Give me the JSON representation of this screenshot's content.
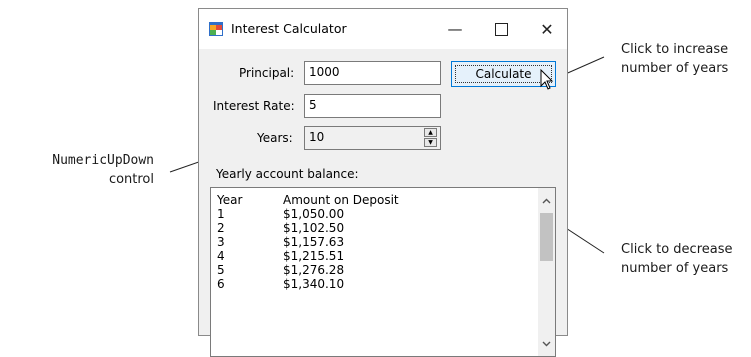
{
  "window": {
    "title": "Interest Calculator",
    "controls": {
      "minimize": "—",
      "maximize": "",
      "close": "✕"
    }
  },
  "form": {
    "principal_label": "Principal:",
    "principal_value": "1000",
    "rate_label": "Interest Rate:",
    "rate_value": "5",
    "years_label": "Years:",
    "years_value": "10",
    "calculate_label": "Calculate",
    "balance_label": "Yearly account balance:"
  },
  "results": {
    "headers": [
      "Year",
      "Amount on Deposit"
    ],
    "rows": [
      [
        "1",
        "$1,050.00"
      ],
      [
        "2",
        "$1,102.50"
      ],
      [
        "3",
        "$1,157.63"
      ],
      [
        "4",
        "$1,215.51"
      ],
      [
        "5",
        "$1,276.28"
      ],
      [
        "6",
        "$1,340.10"
      ]
    ]
  },
  "annotations": {
    "updown_name": "NumericUpDown",
    "updown_suffix": "control",
    "increase_line1": "Click to increase",
    "increase_line2": "number of years",
    "decrease_line1": "Click to decrease",
    "decrease_line2": "number of years"
  },
  "icons": {
    "app": "app-window-icon",
    "spin_up": "triangle-up-icon",
    "spin_down": "triangle-down-icon",
    "scroll_up": "chevron-up-icon",
    "scroll_down": "chevron-down-icon",
    "cursor": "mouse-pointer-icon"
  }
}
